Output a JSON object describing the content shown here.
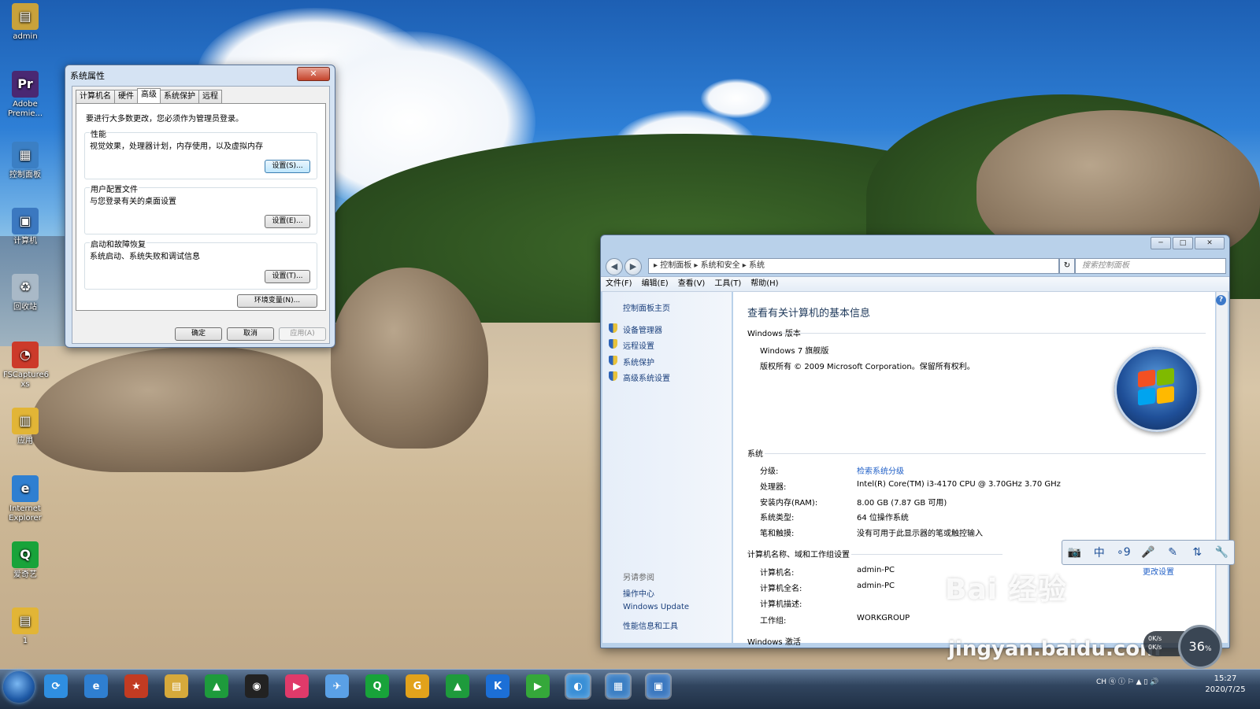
{
  "desktop": {
    "icons": [
      {
        "label": "admin",
        "color": "#c8a23b"
      },
      {
        "label": "Adobe Premie...",
        "color": "#4a2872"
      },
      {
        "label": "控制面板",
        "color": "#3b7fc4"
      },
      {
        "label": "计算机",
        "color": "#3b78c0"
      },
      {
        "label": "回收站",
        "color": "#a9b9c7"
      },
      {
        "label": "FSCapture6 xs",
        "color": "#cc3a2a"
      },
      {
        "label": "应用",
        "color": "#e2b536"
      },
      {
        "label": "Internet Explorer",
        "color": "#2f7fd1"
      },
      {
        "label": "爱奇艺",
        "color": "#18a33a"
      },
      {
        "label": "1",
        "color": "#e2b536"
      }
    ]
  },
  "sysprops": {
    "title": "系统属性",
    "close": "✕",
    "tabs": [
      "计算机名",
      "硬件",
      "高级",
      "系统保护",
      "远程"
    ],
    "note": "要进行大多数更改，您必须作为管理员登录。",
    "groups": [
      {
        "title": "性能",
        "desc": "视觉效果，处理器计划，内存使用，以及虚拟内存",
        "button": "设置(S)..."
      },
      {
        "title": "用户配置文件",
        "desc": "与您登录有关的桌面设置",
        "button": "设置(E)..."
      },
      {
        "title": "启动和故障恢复",
        "desc": "系统启动、系统失败和调试信息",
        "button": "设置(T)..."
      }
    ],
    "env_button": "环境变量(N)...",
    "ok": "确定",
    "cancel": "取消",
    "apply": "应用(A)"
  },
  "cp": {
    "controls": {
      "min": "─",
      "max": "□",
      "close": "✕"
    },
    "nav": {
      "back": "◀",
      "forward": "▶"
    },
    "breadcrumb": "▸  控制面板  ▸  系统和安全  ▸  系统",
    "refresh": "↻",
    "search_placeholder": "搜索控制面板",
    "menus": [
      "文件(F)",
      "编辑(E)",
      "查看(V)",
      "工具(T)",
      "帮助(H)"
    ],
    "left": {
      "home": "控制面板主页",
      "links": [
        "设备管理器",
        "远程设置",
        "系统保护",
        "高级系统设置"
      ],
      "see_also": "另请参阅",
      "see_links": [
        "操作中心",
        "Windows Update",
        "性能信息和工具"
      ]
    },
    "help": "?",
    "title": "查看有关计算机的基本信息",
    "edition_header": "Windows 版本",
    "edition": "Windows 7 旗舰版",
    "copyright": "版权所有 © 2009 Microsoft Corporation。保留所有权利。",
    "system_header": "系统",
    "system": [
      {
        "k": "分级:",
        "v": "检索系统分级",
        "link": true
      },
      {
        "k": "处理器:",
        "v": "Intel(R) Core(TM) i3-4170 CPU @ 3.70GHz   3.70 GHz"
      },
      {
        "k": "安装内存(RAM):",
        "v": "8.00 GB (7.87 GB 可用)"
      },
      {
        "k": "系统类型:",
        "v": "64 位操作系统"
      },
      {
        "k": "笔和触摸:",
        "v": "没有可用于此显示器的笔或触控输入"
      }
    ],
    "name_header": "计算机名称、域和工作组设置",
    "name": [
      {
        "k": "计算机名:",
        "v": "admin-PC"
      },
      {
        "k": "计算机全名:",
        "v": "admin-PC"
      },
      {
        "k": "计算机描述:",
        "v": ""
      },
      {
        "k": "工作组:",
        "v": "WORKGROUP"
      }
    ],
    "change_settings": "更改设置",
    "activation_header": "Windows 激活"
  },
  "ime": [
    "📷",
    "中",
    "∘9",
    "🎤",
    "✎",
    "⇅",
    "🔧"
  ],
  "watermark": {
    "brand": "Bai 经验",
    "url": "jingyan.baidu.com"
  },
  "netspeed": {
    "up": "0K/s",
    "down": "0K/s"
  },
  "gauge": "36",
  "taskbar": {
    "apps": [
      {
        "name": "360-icon",
        "color": "#2f8ee0",
        "glyph": "⟳"
      },
      {
        "name": "ie-icon",
        "color": "#2f7fd1",
        "glyph": "e"
      },
      {
        "name": "badge-icon",
        "color": "#c23b22",
        "glyph": "★"
      },
      {
        "name": "explorer-icon",
        "color": "#d6a93b",
        "glyph": "▤"
      },
      {
        "name": "green-app-icon",
        "color": "#1e9b3c",
        "glyph": "▲"
      },
      {
        "name": "qq-icon",
        "color": "#222222",
        "glyph": "◉"
      },
      {
        "name": "youku-icon",
        "color": "#e03a6a",
        "glyph": "▶"
      },
      {
        "name": "feige-icon",
        "color": "#5aa0e6",
        "glyph": "✈"
      },
      {
        "name": "iqiyi-icon",
        "color": "#18a33a",
        "glyph": "Q"
      },
      {
        "name": "g-app-icon",
        "color": "#e2a21b",
        "glyph": "G"
      },
      {
        "name": "green-app2-icon",
        "color": "#1e9b3c",
        "glyph": "▲"
      },
      {
        "name": "kugou-icon",
        "color": "#1c6fd6",
        "glyph": "K"
      },
      {
        "name": "player-icon",
        "color": "#35a83a",
        "glyph": "▶"
      },
      {
        "name": "browser-icon",
        "color": "#3a8fd6",
        "glyph": "◐"
      },
      {
        "name": "control-panel-icon",
        "color": "#3b7fc4",
        "glyph": "▦"
      },
      {
        "name": "system-window-icon",
        "color": "#3b78c0",
        "glyph": "▣"
      }
    ],
    "tray": "CH  ⓠ  ⓘ  ⚐  ▲  ▯  🔊",
    "time": "15:27",
    "date": "2020/7/25"
  }
}
